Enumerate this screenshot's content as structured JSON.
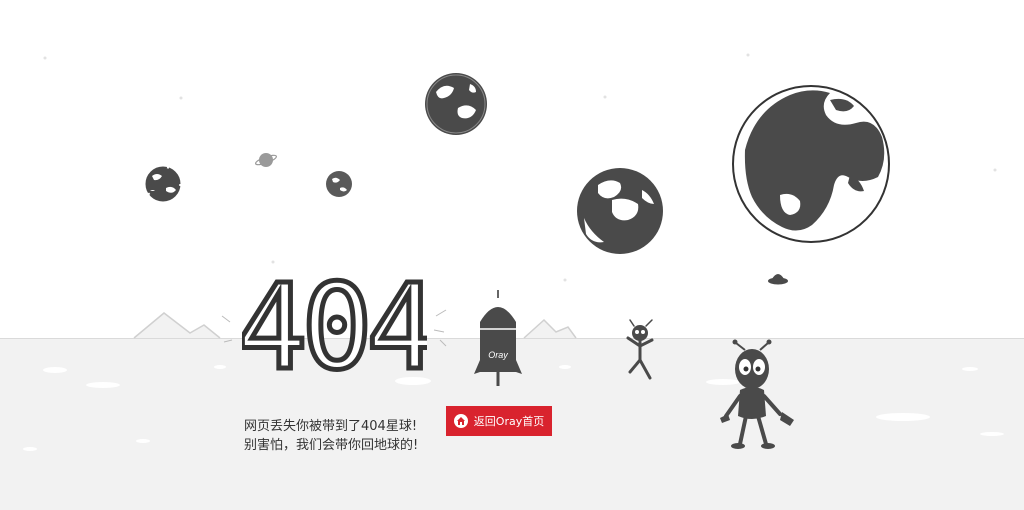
{
  "error": {
    "code": "404",
    "line1": "网页丢失你被带到了404星球!",
    "line2": "别害怕，我们会带你回地球的!"
  },
  "home_button": {
    "label": "返回Oray首页",
    "icon": "home-icon"
  },
  "rocket": {
    "brand": "Oray"
  },
  "colors": {
    "ground": "#f2f2f2",
    "planet": "#4a4a4a",
    "button": "#d9232e",
    "text": "#333333"
  }
}
